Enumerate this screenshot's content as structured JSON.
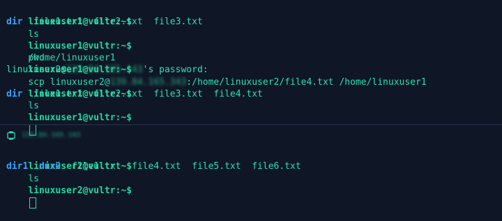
{
  "top": {
    "prompt": "linuxuser1@vultr:~$",
    "line1_cmd": "ls",
    "line2": {
      "dir": "dir",
      "files": "file1.txt  file2.txt  file3.txt"
    },
    "line3_cmd": "pwd",
    "line4": "/home/linuxuser1",
    "line5": {
      "cmd_prefix": "scp linuxuser2@",
      "ip_blurred": "139.84.165.343",
      "cmd_suffix": ":/home/linuxuser2/file4.txt /home/linuxuser1"
    },
    "line6": {
      "prefix": "linuxuser2@",
      "ip_blurred": "139.84.165.143",
      "suffix": "'s password:"
    },
    "line7_cmd": "ls",
    "line8": {
      "dir": "dir",
      "files": "file1.txt  file2.txt  file3.txt  file4.txt"
    }
  },
  "bottom": {
    "host_blurred": "139.84.165.143",
    "prompt": "linuxuser2@vultr:~$",
    "line1_cmd": "ls",
    "line2": {
      "dir1": "dir1",
      "dir2": "dir2",
      "files": "file1.txt  file4.txt  file5.txt  file6.txt"
    }
  },
  "icons": {
    "host": "terminal-host-icon"
  }
}
